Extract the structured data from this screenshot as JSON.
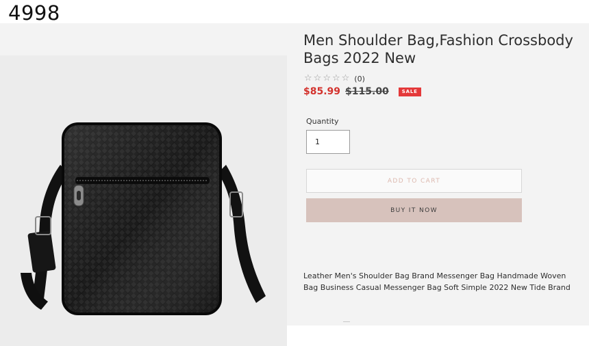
{
  "page_number": "4998",
  "product": {
    "title": "Men Shoulder Bag,Fashion Crossbody Bags 2022 New",
    "rating": {
      "stars": 0,
      "max_stars": 5,
      "review_count": "(0)"
    },
    "price": {
      "sale": "$85.99",
      "regular": "$115.00",
      "badge": "SALE"
    },
    "quantity": {
      "label": "Quantity",
      "value": "1"
    },
    "buttons": {
      "add_to_cart": "ADD TO CART",
      "buy_now": "BUY IT NOW"
    },
    "description": "Leather Men's Shoulder Bag Brand Messenger Bag Handmade Woven Bag Business Casual Messenger Bag Soft Simple 2022 New Tide Brand"
  },
  "colors": {
    "sale_price": "#d3322d",
    "sale_badge": "#e4393a",
    "buy_button": "#d7c2bc",
    "add_to_cart_text": "#dcb8ae"
  },
  "image": {
    "subject": "black woven leather crossbody shoulder bag"
  }
}
